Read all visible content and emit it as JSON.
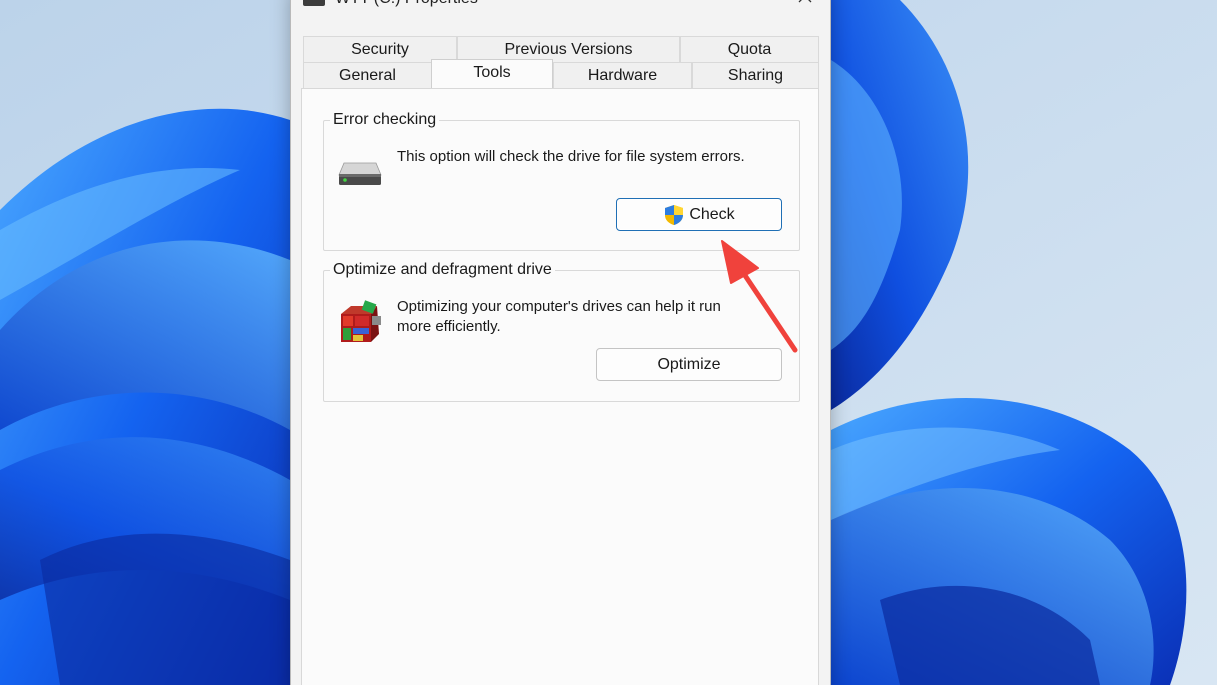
{
  "window": {
    "title": "WTT (C:) Properties",
    "close_icon": "close-icon",
    "drive_icon": "drive-icon"
  },
  "tabs": {
    "row1": [
      {
        "label": "Security"
      },
      {
        "label": "Previous Versions"
      },
      {
        "label": "Quota"
      }
    ],
    "row2": [
      {
        "label": "General"
      },
      {
        "label": "Tools"
      },
      {
        "label": "Hardware"
      },
      {
        "label": "Sharing"
      }
    ],
    "selected": "Tools"
  },
  "error_checking": {
    "heading": "Error checking",
    "description": "This option will check the drive for file system errors.",
    "button_label": "Check",
    "icon": "hard-drive-icon",
    "button_icon": "uac-shield-icon"
  },
  "optimize": {
    "heading": "Optimize and defragment drive",
    "description": "Optimizing your computer's drives can help it run more efficiently.",
    "button_label": "Optimize",
    "icon": "defrag-icon"
  },
  "colors": {
    "accent": "#1f6fb5",
    "annotation_arrow": "#f0423c",
    "wallpaper_blue": "#1e5fe0"
  }
}
